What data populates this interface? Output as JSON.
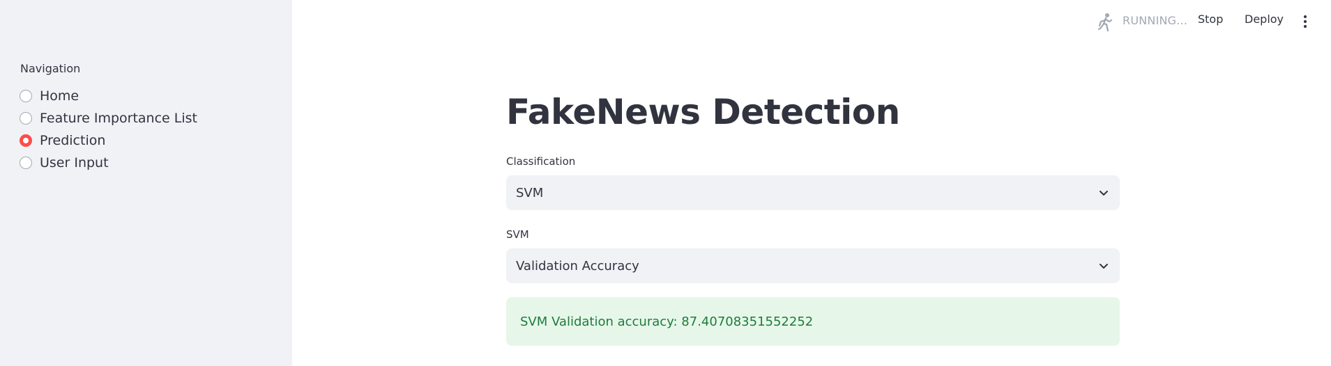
{
  "sidebar": {
    "heading": "Navigation",
    "items": [
      {
        "label": "Home",
        "selected": false
      },
      {
        "label": "Feature Importance List",
        "selected": false
      },
      {
        "label": "Prediction",
        "selected": true
      },
      {
        "label": "User Input",
        "selected": false
      }
    ]
  },
  "header": {
    "status_text": "RUNNING...",
    "status_icon": "running-person-icon",
    "stop_label": "Stop",
    "deploy_label": "Deploy",
    "menu_icon": "vertical-ellipsis-icon"
  },
  "main": {
    "title": "FakeNews Detection",
    "classification": {
      "label": "Classification",
      "value": "SVM"
    },
    "svm": {
      "label": "SVM",
      "value": "Validation Accuracy"
    },
    "result": {
      "text": "SVM Validation accuracy: 87.40708351552252"
    }
  },
  "colors": {
    "sidebar_bg": "#f0f2f6",
    "accent": "#ff4b4b",
    "success_bg": "#e6f7ea",
    "success_text": "#1f7a3a",
    "text": "#31333f",
    "muted": "#a3a8b4"
  }
}
